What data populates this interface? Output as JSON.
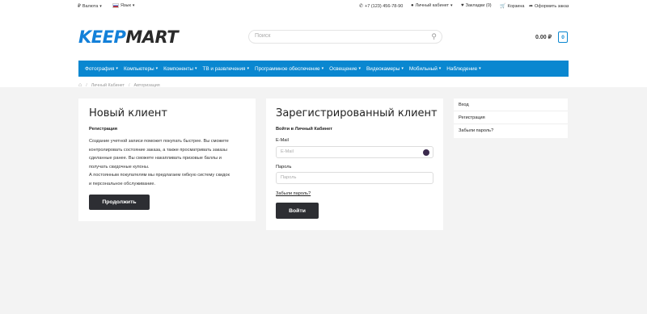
{
  "topbar": {
    "currency": "Валюта",
    "language": "Язык",
    "phone": "+7 (123) 456-78-90",
    "account": "Личный кабинет",
    "wishlist": "Закладки (0)",
    "cart": "Корзина",
    "checkout": "Оформить заказ"
  },
  "header": {
    "logo_keep": "KEEP",
    "logo_mart": "MART",
    "search_placeholder": "Поиск",
    "cart_total": "0.00 ₽",
    "cart_count": "0"
  },
  "nav": {
    "items": [
      {
        "label": "Фотография"
      },
      {
        "label": "Компьютеры"
      },
      {
        "label": "Компоненты"
      },
      {
        "label": "ТВ и развлечения"
      },
      {
        "label": "Программное обеспечение"
      },
      {
        "label": "Освещение"
      },
      {
        "label": "Видеокамеры"
      },
      {
        "label": "Мобильный"
      },
      {
        "label": "Наблюдение"
      }
    ]
  },
  "breadcrumb": {
    "items": [
      "Личный Кабинет",
      "Авторизация"
    ]
  },
  "new_client": {
    "title": "Новый клиент",
    "subtitle": "Регистрация",
    "text_1": "Создание учетной записи поможет покупать быстрее. Вы сможете",
    "text_2": "контролировать состояние заказа, а также просматривать заказы",
    "text_3": "сделанные ранее. Вы сможете накапливать призовые баллы и",
    "text_4": "получать скидочные купоны.",
    "text_5": "А постоянным покупателям мы предлагаем гибкую систему скидок",
    "text_6": "и персональное обслуживание.",
    "button": "Продолжить"
  },
  "login": {
    "title": "Зарегистрированный клиент",
    "subtitle": "Войти в Личный Кабинет",
    "email_label": "E-Mail",
    "email_placeholder": "E-Mail",
    "password_label": "Пароль",
    "password_placeholder": "Пароль",
    "forgot": "Забыли пароль?",
    "button": "Войти"
  },
  "sidebar": {
    "items": [
      {
        "label": "Вход"
      },
      {
        "label": "Регистрация"
      },
      {
        "label": "Забыли пароль?"
      }
    ]
  },
  "colors": {
    "accent": "#0a87d0",
    "button": "#2d2e33"
  }
}
